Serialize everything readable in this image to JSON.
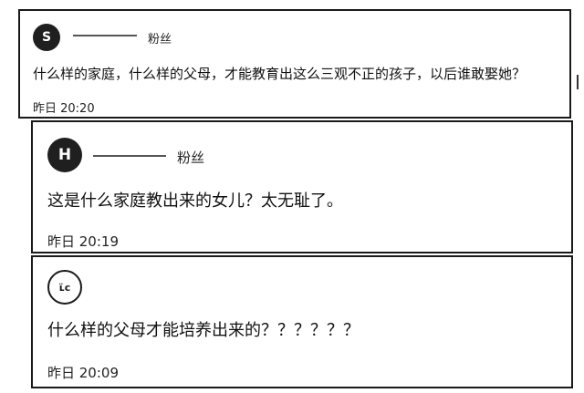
{
  "comments": [
    {
      "avatar_glyph": "S",
      "username": "",
      "fan_tag": "粉丝",
      "text": "什么样的家庭，什么样的父母，才能教育出这么三观不正的孩子，以后谁敢娶她？",
      "time": "昨日 20:20"
    },
    {
      "avatar_glyph": "H",
      "username": "",
      "fan_tag": "粉丝",
      "text": "这是什么家庭教出来的女儿？太无耻了。",
      "time": "昨日 20:19"
    },
    {
      "avatar_glyph": "ʟ̈ᴄ",
      "text": "什么样的父母才能培养出来的？？？？？？",
      "time": "昨日 20:09"
    }
  ]
}
